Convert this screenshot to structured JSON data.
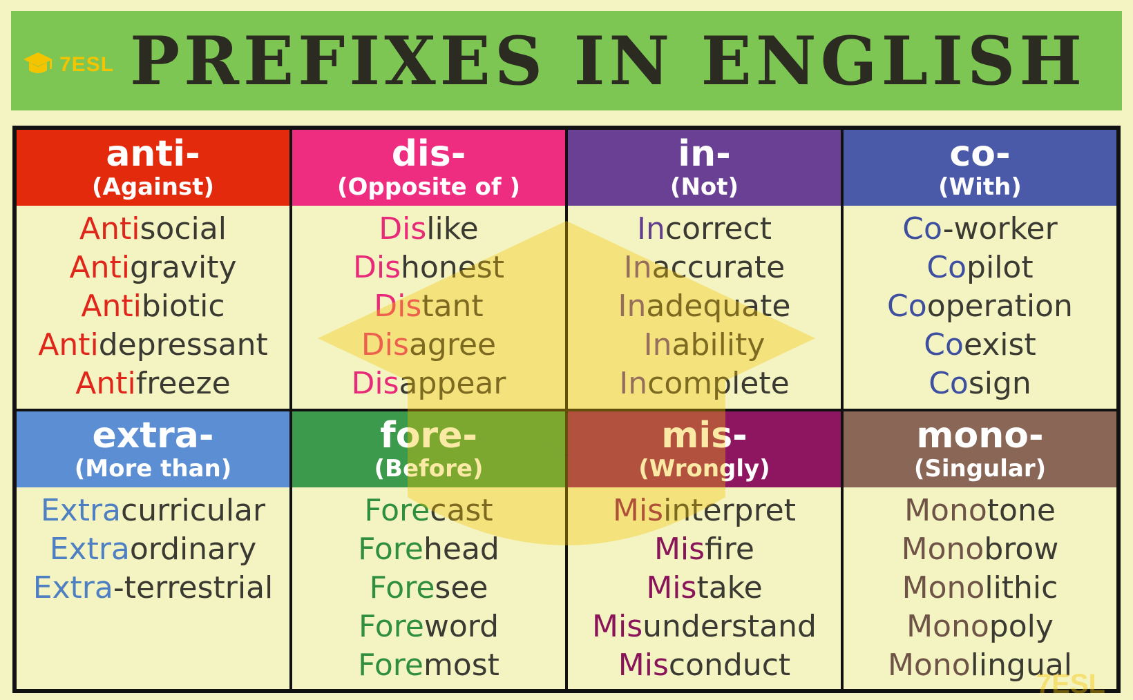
{
  "brand": {
    "name": "7ESL",
    "icon": "graduation-cap-icon",
    "color": "#f5c400"
  },
  "title": "PREFIXES IN ENGLISH",
  "prefixes": [
    {
      "prefix": "anti-",
      "meaning": "(Against)",
      "head_color": "#e42a0c",
      "prefix_color": "#e0261a",
      "words": [
        {
          "pre": "Anti",
          "rest": "social"
        },
        {
          "pre": "Anti",
          "rest": "gravity"
        },
        {
          "pre": "Anti",
          "rest": "biotic"
        },
        {
          "pre": "Anti",
          "rest": "depressant"
        },
        {
          "pre": "Anti",
          "rest": "freeze"
        }
      ]
    },
    {
      "prefix": "dis-",
      "meaning": "(Opposite of )",
      "head_color": "#ef2d80",
      "prefix_color": "#e92a79",
      "words": [
        {
          "pre": "Dis",
          "rest": "like"
        },
        {
          "pre": "Dis",
          "rest": "honest"
        },
        {
          "pre": "Dis",
          "rest": "tant"
        },
        {
          "pre": "Dis",
          "rest": "agree"
        },
        {
          "pre": "Dis",
          "rest": "appear"
        }
      ]
    },
    {
      "prefix": "in-",
      "meaning": "(Not)",
      "head_color": "#6a4095",
      "prefix_color": "#62408e",
      "words": [
        {
          "pre": "In",
          "rest": "correct"
        },
        {
          "pre": "In",
          "rest": "accurate"
        },
        {
          "pre": "In",
          "rest": "adequate"
        },
        {
          "pre": "In",
          "rest": "ability"
        },
        {
          "pre": "In",
          "rest": "complete"
        }
      ]
    },
    {
      "prefix": "co-",
      "meaning": "(With)",
      "head_color": "#4a59a8",
      "prefix_color": "#3f4fa0",
      "words": [
        {
          "pre": "Co",
          "rest": "-worker"
        },
        {
          "pre": "Co",
          "rest": "pilot"
        },
        {
          "pre": "Co",
          "rest": "operation"
        },
        {
          "pre": "Co",
          "rest": "exist"
        },
        {
          "pre": "Co",
          "rest": "sign"
        }
      ]
    },
    {
      "prefix": "extra-",
      "meaning": "(More than)",
      "head_color": "#5b8ed3",
      "prefix_color": "#4d7fc2",
      "words": [
        {
          "pre": "Extra",
          "rest": "curricular"
        },
        {
          "pre": "Extra",
          "rest": "ordinary"
        },
        {
          "pre": "Extra",
          "rest": "-terrestrial"
        }
      ]
    },
    {
      "prefix": "fore-",
      "meaning": "(Before)",
      "head_color": "#3b9a4b",
      "prefix_color": "#2f8f3f",
      "words": [
        {
          "pre": "Fore",
          "rest": "cast"
        },
        {
          "pre": "Fore",
          "rest": "head"
        },
        {
          "pre": "Fore",
          "rest": "see"
        },
        {
          "pre": "Fore",
          "rest": "word"
        },
        {
          "pre": "Fore",
          "rest": "most"
        }
      ]
    },
    {
      "prefix": "mis-",
      "meaning": "(Wrongly)",
      "head_color": "#8e1560",
      "prefix_color": "#8a1459",
      "words": [
        {
          "pre": "Mis",
          "rest": "interpret"
        },
        {
          "pre": "Mis",
          "rest": "fire"
        },
        {
          "pre": "Mis",
          "rest": "take"
        },
        {
          "pre": "Mis",
          "rest": "understand"
        },
        {
          "pre": "Mis",
          "rest": "conduct"
        }
      ]
    },
    {
      "prefix": "mono-",
      "meaning": "(Singular)",
      "head_color": "#8a6657",
      "prefix_color": "#6e5346",
      "words": [
        {
          "pre": "Mono",
          "rest": "tone"
        },
        {
          "pre": "Mono",
          "rest": "brow"
        },
        {
          "pre": "Mono",
          "rest": "lithic"
        },
        {
          "pre": "Mono",
          "rest": "poly"
        },
        {
          "pre": "Mono",
          "rest": "lingual"
        }
      ]
    }
  ]
}
